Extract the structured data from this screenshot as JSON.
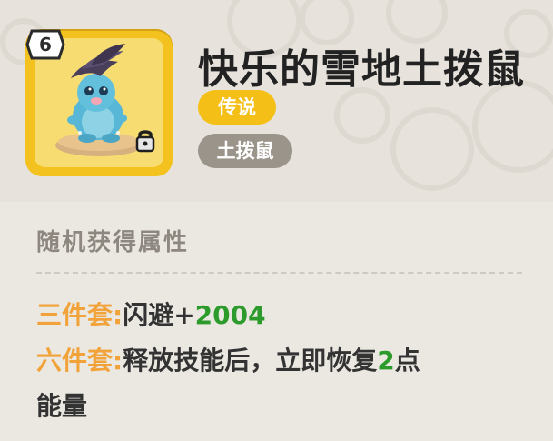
{
  "item": {
    "level": "6",
    "name": "快乐的雪地土拨鼠",
    "rarity": "传说",
    "type": "土拨鼠"
  },
  "attributes": {
    "section_title": "随机获得属性",
    "three_set": {
      "label": "三件套:",
      "stat": "闪避+",
      "value": "2004"
    },
    "six_set": {
      "label": "六件套:",
      "text_part1": "释放技能后，立即恢复",
      "value": "2",
      "text_part2": "点",
      "text_line2": "能量"
    }
  },
  "colors": {
    "card_gold": "#f4c21e",
    "rarity_badge": "#f4bf17",
    "type_badge": "#9b948b",
    "set_label": "#f1a238",
    "value_green": "#2c9b2b"
  },
  "icons": [
    "level-badge-icon",
    "lock-icon",
    "character-portrait"
  ]
}
